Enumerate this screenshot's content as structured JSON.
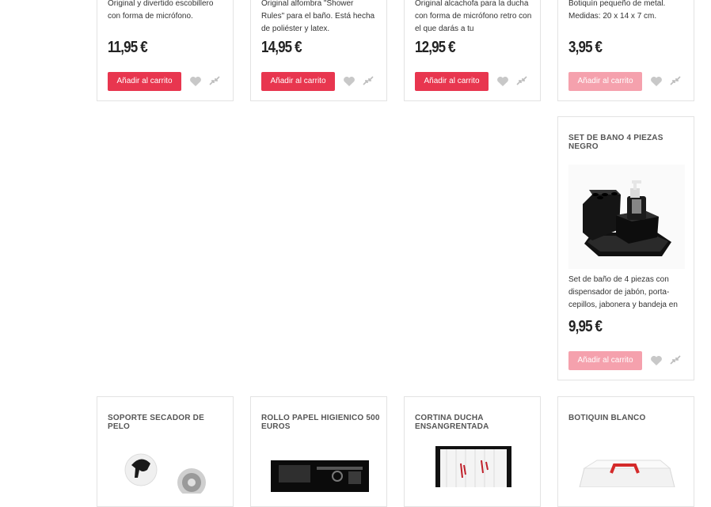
{
  "grid": {
    "top_row": [
      {
        "description": "Original y divertido escobillero con forma de micrófono.",
        "price": "11,95 €",
        "button_label": "Añadir al carrito",
        "button_state": "active"
      },
      {
        "description": "Original alfombra \"Shower Rules\" para el baño. Está hecha de poliéster y latex.",
        "price": "14,95 €",
        "button_label": "Añadir al carrito",
        "button_state": "active"
      },
      {
        "description": "Original alcachofa para la ducha con forma de micrófono retro con el que darás a tu",
        "price": "12,95 €",
        "button_label": "Añadir al carrito",
        "button_state": "active"
      },
      {
        "description": "Botiquín pequeño de metal. Medidas: 20 x 14 x 7 cm.",
        "price": "3,95 €",
        "button_label": "Añadir al carrito",
        "button_state": "disabled"
      }
    ],
    "featured": {
      "title": "SET DE BANO 4 PIEZAS NEGRO",
      "description": "Set de baño de 4 piezas con dispensador de jabón, porta-cepillos, jabonera y bandeja en",
      "price": "9,95 €",
      "button_label": "Añadir al carrito",
      "button_state": "disabled"
    },
    "bottom_row": [
      {
        "title": "SOPORTE SECADOR DE PELO"
      },
      {
        "title": "ROLLO PAPEL HIGIENICO 500 EUROS"
      },
      {
        "title": "CORTINA DUCHA ENSANGRENTADA"
      },
      {
        "title": "BOTIQUIN BLANCO"
      }
    ]
  },
  "icons": {
    "wishlist": "heart-icon",
    "compare": "compare-arrows-icon"
  },
  "colors": {
    "accent": "#e8364f",
    "accent_disabled": "#f5a1ad",
    "border": "#e3e3e3",
    "icon": "#bdbdbd"
  }
}
